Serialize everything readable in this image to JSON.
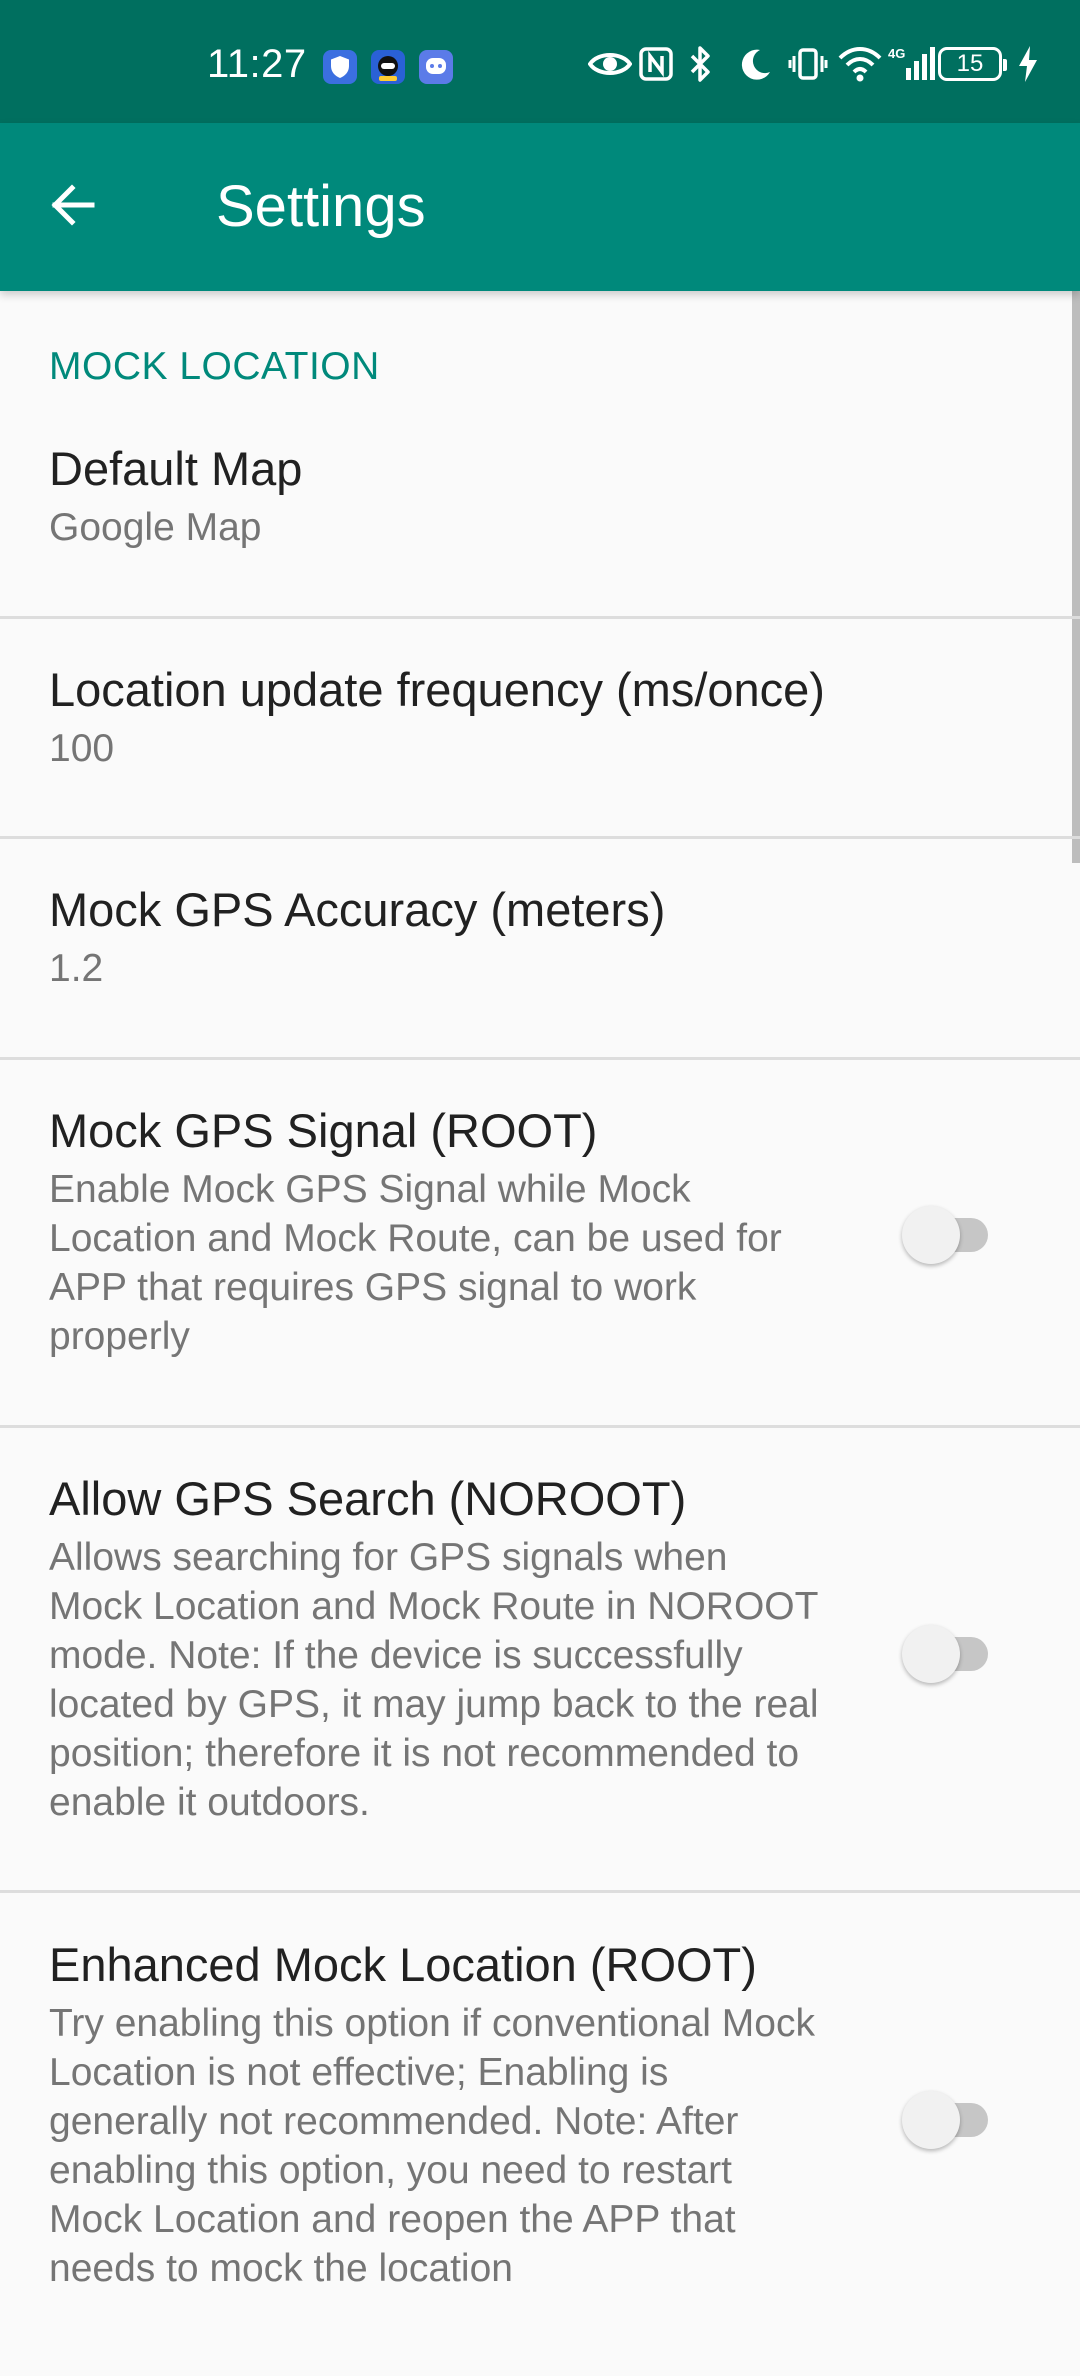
{
  "status_bar": {
    "time": "11:27",
    "battery_level": "15",
    "notification_icons": [
      "shield-app-icon",
      "robot-app-icon",
      "chat-app-icon"
    ],
    "system_icons": [
      "eye-icon",
      "nfc-icon",
      "bluetooth-icon",
      "moon-icon",
      "vibrate-icon",
      "wifi-icon",
      "signal-4g-icon",
      "battery-icon",
      "charging-icon"
    ]
  },
  "app_bar": {
    "title": "Settings",
    "back_icon": "arrow-back-icon"
  },
  "section": {
    "header": "MOCK LOCATION"
  },
  "preferences": [
    {
      "title": "Default Map",
      "summary": "Google Map"
    },
    {
      "title": "Location update frequency (ms/once)",
      "summary": "100"
    },
    {
      "title": "Mock GPS Accuracy (meters)",
      "summary": "1.2"
    },
    {
      "title": "Mock GPS Signal (ROOT)",
      "summary": "Enable Mock GPS Signal while Mock Location and Mock Route, can be used for APP that requires GPS signal to work properly",
      "switch_on": false
    },
    {
      "title": "Allow GPS Search (NOROOT)",
      "summary": "Allows searching for GPS signals when Mock Location and Mock Route in NOROOT mode. Note: If the device is successfully located by GPS, it may jump back to the real position; therefore it is not recommended to enable it outdoors.",
      "switch_on": false
    },
    {
      "title": "Enhanced Mock Location (ROOT)",
      "summary": "Try enabling this option if conventional Mock Location is not effective; Enabling is generally not recommended. Note: After enabling this option, you need to restart Mock Location and reopen the APP that needs to mock the location",
      "switch_on": false
    }
  ],
  "colors": {
    "status_bar": "#006f5f",
    "app_bar": "#00897b",
    "accent": "#00897b",
    "background": "#fafafa"
  }
}
